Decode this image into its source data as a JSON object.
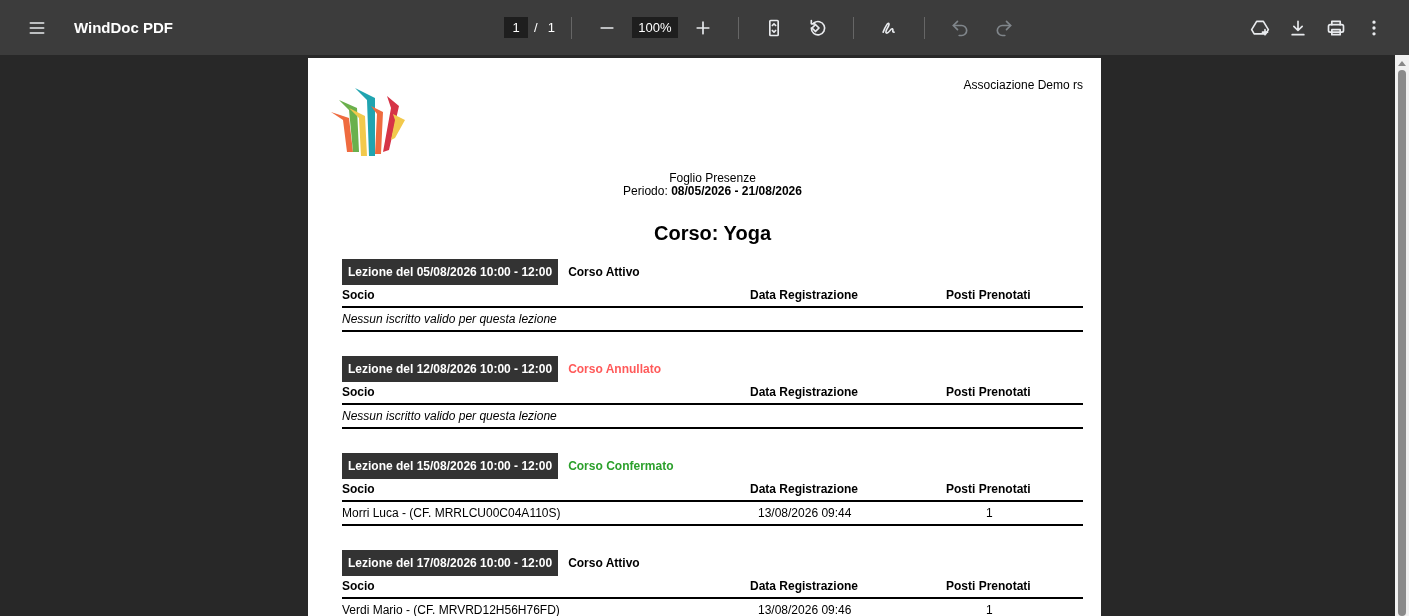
{
  "toolbar": {
    "title": "WindDoc PDF",
    "page_current": "1",
    "page_separator": "/",
    "page_total": "1",
    "zoom": "100%",
    "undo_disabled": true,
    "redo_disabled": true
  },
  "document": {
    "organization": "Associazione Demo rs",
    "heading": "Foglio Presenze",
    "period_label": "Periodo:",
    "period": "08/05/2026 - 21/08/2026",
    "course_title": "Corso: Yoga",
    "lessons": [
      {
        "label": "Lezione del 05/08/2026 10:00 - 12:00",
        "status": "Corso Attivo",
        "color": "#000000",
        "columns": [
          "Socio",
          "Data Registrazione",
          "Posti Prenotati"
        ],
        "empty_message": "Nessun iscritto valido per questa lezione"
      },
      {
        "label": "Lezione del 12/08/2026 10:00 - 12:00",
        "status": "Corso Annullato",
        "color": "#ff5a5a",
        "columns": [
          "Socio",
          "Data Registrazione",
          "Posti Prenotati"
        ],
        "empty_message": "Nessun iscritto valido per questa lezione"
      },
      {
        "label": "Lezione del 15/08/2026 10:00 - 12:00",
        "status": "Corso Confermato",
        "color": "#2ca02c",
        "columns": [
          "Socio",
          "Data Registrazione",
          "Posti Prenotati"
        ],
        "rows": [
          {
            "member": "Morri Luca - (CF. MRRLCU00C04A110S)",
            "registered": "13/08/2026 09:44",
            "seats": "1"
          }
        ]
      },
      {
        "label": "Lezione del 17/08/2026 10:00 - 12:00",
        "status": "Corso Attivo",
        "color": "#000000",
        "columns": [
          "Socio",
          "Data Registrazione",
          "Posti Prenotati"
        ],
        "rows": [
          {
            "member": "Verdi Mario - (CF. MRVRD12H56H76FD)",
            "registered": "13/08/2026 09:46",
            "seats": "1"
          }
        ]
      }
    ]
  }
}
